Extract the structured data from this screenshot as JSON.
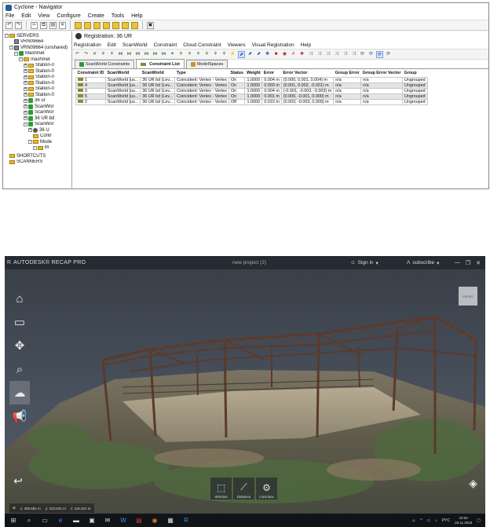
{
  "cyclone": {
    "title": "Cyclone - Navigator",
    "menu": [
      "File",
      "Edit",
      "View",
      "Configure",
      "Create",
      "Tools",
      "Help"
    ],
    "tree": [
      {
        "label": "SERVERS",
        "depth": 0,
        "exp": "-",
        "icon": "fld"
      },
      {
        "label": "VRN09664",
        "depth": 1,
        "exp": "",
        "icon": "srv"
      },
      {
        "label": "VRN09664 (unshared)",
        "depth": 1,
        "exp": "-",
        "icon": "srv"
      },
      {
        "label": "Mashmet",
        "depth": 2,
        "exp": "-",
        "icon": "grn"
      },
      {
        "label": "mashmet",
        "depth": 3,
        "exp": "-",
        "icon": "fld"
      },
      {
        "label": "Station-0",
        "depth": 4,
        "exp": "+",
        "icon": "fld"
      },
      {
        "label": "Station-0",
        "depth": 4,
        "exp": "+",
        "icon": "fld"
      },
      {
        "label": "Station-0",
        "depth": 4,
        "exp": "+",
        "icon": "fld"
      },
      {
        "label": "Station-0",
        "depth": 4,
        "exp": "+",
        "icon": "fld"
      },
      {
        "label": "Station-0",
        "depth": 4,
        "exp": "+",
        "icon": "fld"
      },
      {
        "label": "Station-0",
        "depth": 4,
        "exp": "+",
        "icon": "fld"
      },
      {
        "label": "36 ur",
        "depth": 4,
        "exp": "+",
        "icon": "grn"
      },
      {
        "label": "ScanWor",
        "depth": 4,
        "exp": "+",
        "icon": "grn"
      },
      {
        "label": "ScanWor",
        "depth": 4,
        "exp": "+",
        "icon": "grn"
      },
      {
        "label": "36 UR bd",
        "depth": 4,
        "exp": "+",
        "icon": "grn"
      },
      {
        "label": "ScanWor",
        "depth": 4,
        "exp": "-",
        "icon": "grn"
      },
      {
        "label": "36 U",
        "depth": 5,
        "exp": "+",
        "icon": "reg"
      },
      {
        "label": "Contr",
        "depth": 5,
        "exp": "",
        "icon": "fld"
      },
      {
        "label": "Mode",
        "depth": 5,
        "exp": "-",
        "icon": "fld"
      },
      {
        "label": "M",
        "depth": 6,
        "exp": "-",
        "icon": "fld"
      }
    ],
    "tree_bottom": [
      "SHORTCUTS",
      "SCANNERS"
    ],
    "registration": {
      "title": "Registration: 36 UR",
      "menu": [
        "Registration",
        "Edit",
        "ScanWorld",
        "Constraint",
        "Cloud Constraint",
        "Viewers",
        "Visual Registration",
        "Help"
      ],
      "tabs": [
        "ScanWorld Constraints",
        "Constraint List",
        "ModelSpaces"
      ],
      "active_tab": 1,
      "columns": [
        "Constraint ID",
        "ScanWorld",
        "ScanWorld",
        "Type",
        "Status",
        "Weight",
        "Error",
        "Error Vector",
        "Group Error",
        "Group Error Vector",
        "Group"
      ],
      "rows": [
        [
          "1",
          "ScanWorld [us...",
          "36 UR bd (Lev...",
          "Coincident: Vertex - Vertex",
          "On",
          "1.0000",
          "0.004 m",
          "(0.000, 0.001, 0.004) m",
          "n/a",
          "n/a",
          "Ungrouped"
        ],
        [
          "4",
          "ScanWorld [us...",
          "36 UR bd (Lev...",
          "Coincident: Vertex - Vertex",
          "On",
          "1.0000",
          "0.003 m",
          "(0.001, 0.002, -0.001) m",
          "n/a",
          "n/a",
          "Ungrouped"
        ],
        [
          "3",
          "ScanWorld [us...",
          "36 UR bd (Lev...",
          "Coincident: Vertex - Vertex",
          "On",
          "1.0000",
          "0.004 m",
          "(-0.001, -0.003, -0.003) m",
          "n/a",
          "n/a",
          "Ungrouped"
        ],
        [
          "5",
          "ScanWorld [us...",
          "36 UR bd (Lev...",
          "Coincident: Vertex - Vertex",
          "On",
          "1.0000",
          "0.001 m",
          "(0.000, -0.001, 0.000) m",
          "n/a",
          "n/a",
          "Ungrouped"
        ],
        [
          "2",
          "ScanWorld [us...",
          "36 UR bd (Lev...",
          "Coincident: Vertex - Vertex",
          "Off",
          "1.0000",
          "0.010 m",
          "(0.003, -0.003, 0.009) m",
          "n/a",
          "n/a",
          "Ungrouped"
        ]
      ]
    }
  },
  "recap": {
    "brand": "AUTODESK® RECAP PRO",
    "project": "new project (2)",
    "signin": "Sign in",
    "subscribe": "subscribe",
    "viewcube_label": "FRONT",
    "bottom_tools": [
      "Window",
      "Distance",
      "Limit Box"
    ],
    "coords": {
      "x": "x: 405.581 m",
      "y": "y: 223.041 m",
      "z": "z: 116.421 m"
    },
    "clock_time": "23:00",
    "clock_date": "25.11.2018",
    "lang": "PYC"
  }
}
